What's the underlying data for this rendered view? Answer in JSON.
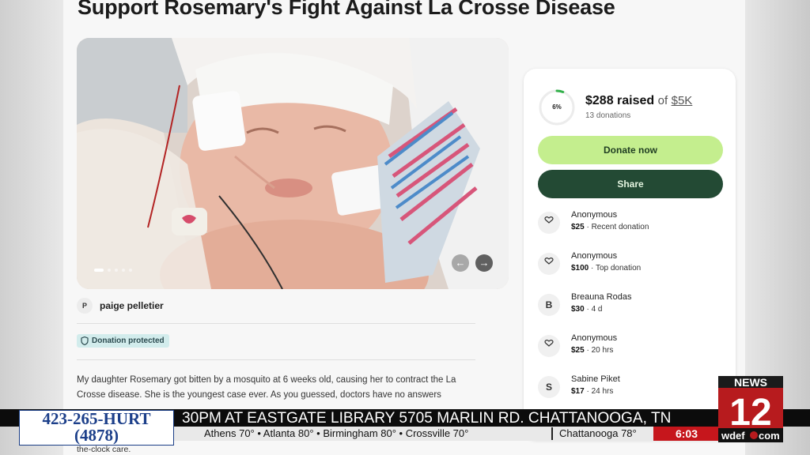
{
  "page_title": "Support Rosemary's Fight Against La Crosse Disease",
  "photo": {
    "description_icon": "photo-carousel",
    "prev_icon": "arrow-left-icon",
    "next_icon": "arrow-right-icon",
    "slide_index": 1
  },
  "organizer": {
    "initial": "P",
    "name": "paige pelletier"
  },
  "badge": {
    "label": "Donation protected",
    "icon": "shield-icon"
  },
  "story": {
    "text": "My daughter Rosemary got bitten by a mosquito at 6 weeks old, causing her to contract the La Crosse disease. She is the youngest case ever. As you guessed, doctors have no answers",
    "tail": "the-clock care."
  },
  "fundraiser": {
    "progress_percent_label": "6%",
    "progress_fraction": 0.06,
    "raised": "$288 raised",
    "of": "of",
    "goal": "$5K",
    "donation_count": "13 donations",
    "donate_label": "Donate now",
    "share_label": "Share",
    "accent_green": "#c4ee8e",
    "dark_green": "#234a34"
  },
  "donations": [
    {
      "icon": "heart-hand-icon",
      "initial": "",
      "name": "Anonymous",
      "amount": "$25",
      "detail": " · Recent donation"
    },
    {
      "icon": "heart-hand-icon",
      "initial": "",
      "name": "Anonymous",
      "amount": "$100",
      "detail": " · Top donation"
    },
    {
      "icon": "",
      "initial": "B",
      "name": "Breauna Rodas",
      "amount": "$30",
      "detail": " · 4 d"
    },
    {
      "icon": "heart-hand-icon",
      "initial": "",
      "name": "Anonymous",
      "amount": "$25",
      "detail": " · 20 hrs"
    },
    {
      "icon": "",
      "initial": "S",
      "name": "Sabine Piket",
      "amount": "$17",
      "detail": " · 24 hrs"
    }
  ],
  "broadcast": {
    "phone_line1": "423-265-HURT",
    "phone_line2": "(4878)",
    "ticker": "30PM AT EASTGATE LIBRARY 5705 MARLIN RD. CHATTANOOGA, TN",
    "weather": "Athens 70° • Atlanta 80° • Birmingham 80° • Crossville 70°",
    "weather_city": "Chattanooga 78°",
    "time": "6:03",
    "logo_top": "NEWS",
    "logo_number": "12",
    "logo_site": "wdef",
    "logo_domain": "com"
  }
}
